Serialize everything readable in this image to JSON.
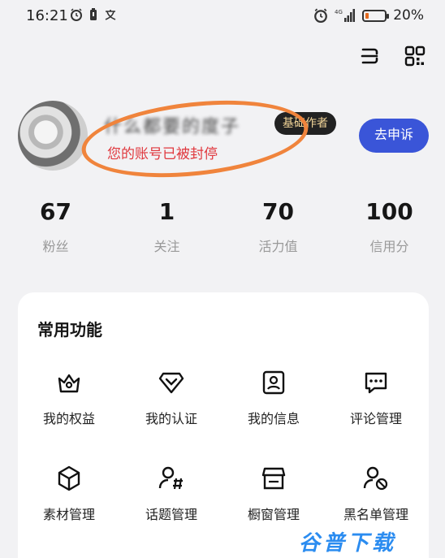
{
  "status_bar": {
    "time": "16:21",
    "battery_text": "20%",
    "battery_level": 0.2,
    "network": "4G"
  },
  "profile": {
    "nickname": "什么都要的度子",
    "author_badge": "基础作者",
    "banned_notice": "您的账号已被封停",
    "appeal_label": "去申诉"
  },
  "stats": [
    {
      "value": "67",
      "label": "粉丝"
    },
    {
      "value": "1",
      "label": "关注"
    },
    {
      "value": "70",
      "label": "活力值"
    },
    {
      "value": "100",
      "label": "信用分"
    }
  ],
  "functions": {
    "title": "常用功能",
    "items": [
      {
        "label": "我的权益",
        "icon": "crown-icon"
      },
      {
        "label": "我的认证",
        "icon": "verify-icon"
      },
      {
        "label": "我的信息",
        "icon": "id-card-icon"
      },
      {
        "label": "评论管理",
        "icon": "comment-icon"
      },
      {
        "label": "素材管理",
        "icon": "cube-icon"
      },
      {
        "label": "话题管理",
        "icon": "topic-icon"
      },
      {
        "label": "橱窗管理",
        "icon": "store-icon"
      },
      {
        "label": "黑名单管理",
        "icon": "blacklist-icon"
      }
    ]
  },
  "watermark": "谷普下载",
  "colors": {
    "accent": "#3a55d8",
    "danger": "#e0383e",
    "highlight": "#f0843c"
  }
}
